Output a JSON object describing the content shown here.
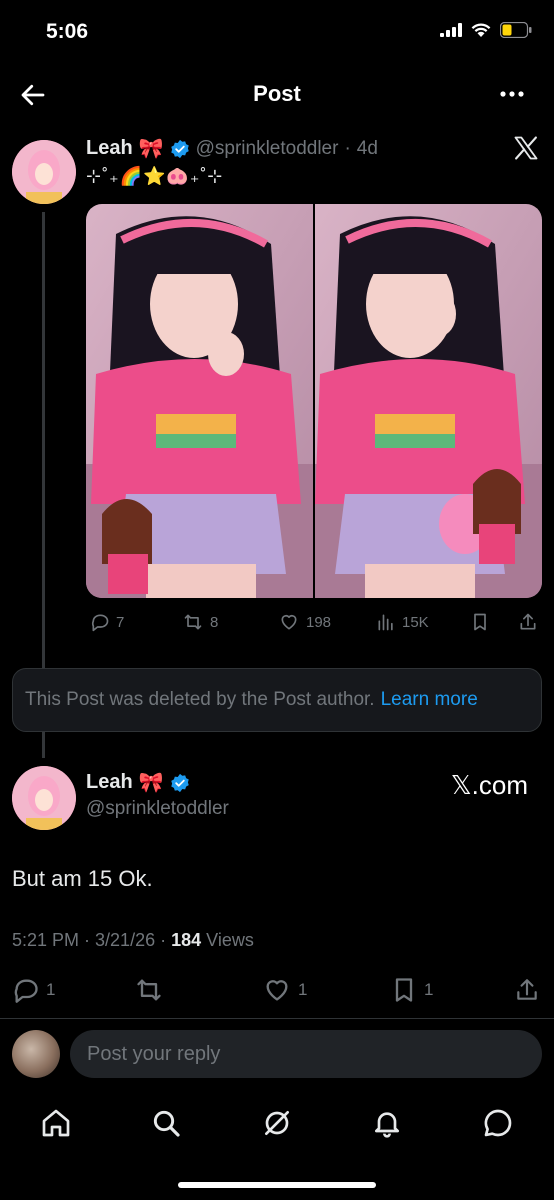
{
  "status_bar": {
    "time": "5:06",
    "icons": [
      "signal-icon",
      "wifi-icon",
      "battery-icon"
    ],
    "battery_color": "#ffd60a"
  },
  "header": {
    "title": "Post",
    "back_icon": "arrow-left-icon",
    "more_icon": "more-horizontal-icon"
  },
  "parent_post": {
    "author_name": "Leah",
    "author_emoji": "🎀",
    "verified": true,
    "handle": "@sprinkletoddler",
    "time_sep": "·",
    "age": "4d",
    "source_icon": "x-logo-icon",
    "text": "⊹˚₊🌈⭐🐽₊˚⊹",
    "media_count": 2,
    "actions": {
      "replies": "7",
      "reposts": "8",
      "likes": "198",
      "views": "15K"
    }
  },
  "deleted_notice": {
    "text": "This Post was deleted by the Post author.",
    "link": "Learn more"
  },
  "main_post": {
    "author_name": "Leah",
    "author_emoji": "🎀",
    "verified": true,
    "handle": "@sprinkletoddler",
    "source": "𝕏.com",
    "text": "But am 15 Ok.",
    "timestamp": "5:21 PM · 3/21/26 ·",
    "views_count": "184",
    "views_label": "Views",
    "actions": {
      "replies": "1",
      "reposts": "",
      "likes": "1",
      "bookmarks": "1"
    }
  },
  "reply_bar": {
    "placeholder": "Post your reply"
  },
  "bottom_nav": {
    "items": [
      "home-icon",
      "search-icon",
      "grok-icon",
      "notifications-icon",
      "messages-icon"
    ]
  },
  "colors": {
    "background": "#000000",
    "text_primary": "#e7e9ea",
    "text_secondary": "#71767b",
    "accent": "#1d9bf0",
    "divider": "#2f3336"
  }
}
